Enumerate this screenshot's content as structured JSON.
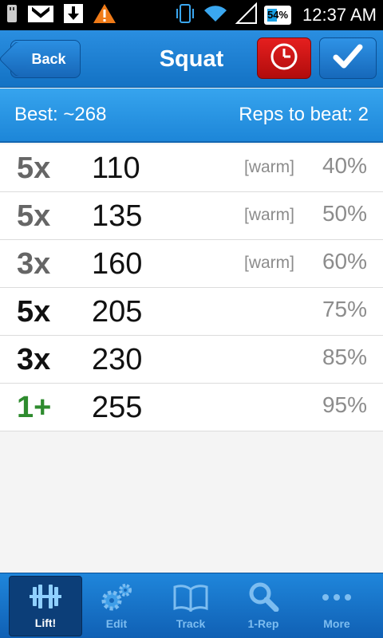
{
  "status": {
    "battery": "54%",
    "battery_level": 0.54,
    "time": "12:37 AM"
  },
  "header": {
    "back_label": "Back",
    "title": "Squat",
    "timer_icon": "clock-icon",
    "confirm_icon": "checkmark-icon",
    "colors": {
      "bar": "#1a7fd4",
      "timer": "#d31515",
      "confirm": "#1f7bd0"
    }
  },
  "info": {
    "best": "Best: ~268",
    "reps_to_beat": "Reps to beat: 2"
  },
  "sets": [
    {
      "reps": "5x",
      "weight": "110",
      "note": "[warm]",
      "percent": "40%",
      "style": "gray"
    },
    {
      "reps": "5x",
      "weight": "135",
      "note": "[warm]",
      "percent": "50%",
      "style": "gray"
    },
    {
      "reps": "3x",
      "weight": "160",
      "note": "[warm]",
      "percent": "60%",
      "style": "gray"
    },
    {
      "reps": "5x",
      "weight": "205",
      "note": "",
      "percent": "75%",
      "style": "black"
    },
    {
      "reps": "3x",
      "weight": "230",
      "note": "",
      "percent": "85%",
      "style": "black"
    },
    {
      "reps": "1+",
      "weight": "255",
      "note": "",
      "percent": "95%",
      "style": "green"
    }
  ],
  "tabs": [
    {
      "label": "Lift!",
      "icon": "barbell-icon",
      "active": true
    },
    {
      "label": "Edit",
      "icon": "gears-icon",
      "active": false
    },
    {
      "label": "Track",
      "icon": "book-icon",
      "active": false
    },
    {
      "label": "1-Rep",
      "icon": "search-icon",
      "active": false
    },
    {
      "label": "More",
      "icon": "more-dots-icon",
      "active": false
    }
  ]
}
